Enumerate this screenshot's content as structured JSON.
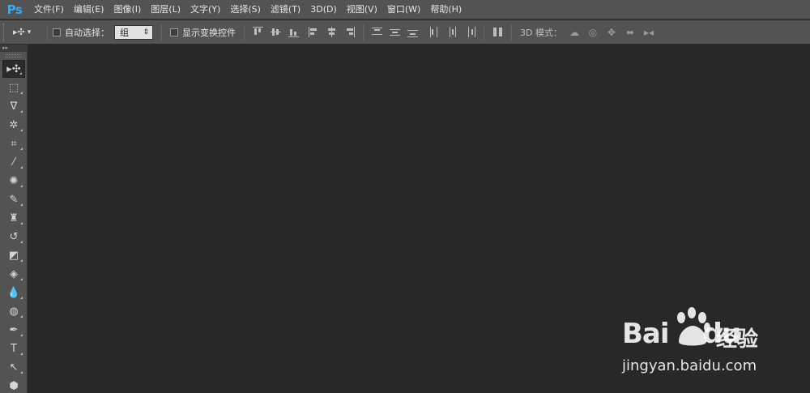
{
  "app": {
    "logo": "Ps"
  },
  "menu": {
    "items": [
      "文件(F)",
      "编辑(E)",
      "图像(I)",
      "图层(L)",
      "文字(Y)",
      "选择(S)",
      "滤镜(T)",
      "3D(D)",
      "视图(V)",
      "窗口(W)",
      "帮助(H)"
    ]
  },
  "options": {
    "auto_select_label": "自动选择：",
    "auto_select_value": "组",
    "show_transform_label": "显示变换控件",
    "mode_3d_label": "3D 模式：",
    "select_arrow": "⇕",
    "preset_arrow": "▾"
  },
  "toolbar": {
    "collapse": "▸▸",
    "tools": [
      {
        "name": "move-tool",
        "glyph": "▸✣"
      },
      {
        "name": "marquee-tool",
        "glyph": "⬚"
      },
      {
        "name": "lasso-tool",
        "glyph": "ᐁ"
      },
      {
        "name": "magic-wand-tool",
        "glyph": "✲"
      },
      {
        "name": "crop-tool",
        "glyph": "⌗"
      },
      {
        "name": "eyedropper-tool",
        "glyph": "⁄"
      },
      {
        "name": "spot-healing-tool",
        "glyph": "✺"
      },
      {
        "name": "brush-tool",
        "glyph": "✎"
      },
      {
        "name": "clone-stamp-tool",
        "glyph": "♜"
      },
      {
        "name": "history-brush-tool",
        "glyph": "↺"
      },
      {
        "name": "eraser-tool",
        "glyph": "◩"
      },
      {
        "name": "paint-bucket-tool",
        "glyph": "◈"
      },
      {
        "name": "blur-tool",
        "glyph": "💧"
      },
      {
        "name": "dodge-tool",
        "glyph": "◍"
      },
      {
        "name": "pen-tool",
        "glyph": "✒"
      },
      {
        "name": "type-tool",
        "glyph": "T"
      },
      {
        "name": "path-selection-tool",
        "glyph": "↖"
      },
      {
        "name": "shape-tool",
        "glyph": "⬢"
      }
    ]
  },
  "watermark": {
    "brand": "Bai",
    "brand2": "du",
    "product": "经验",
    "url": "jingyan.baidu.com"
  },
  "colors": {
    "menubar": "#535353",
    "workspace": "#282828",
    "logo": "#3fa7e8"
  }
}
